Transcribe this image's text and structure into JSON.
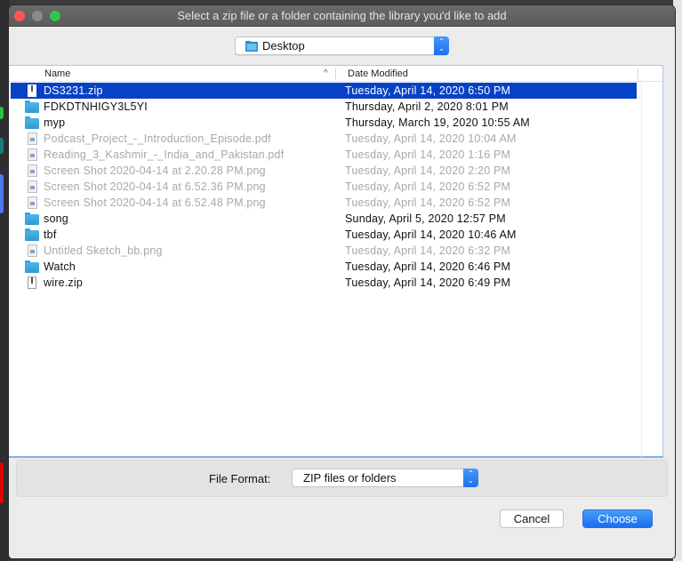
{
  "window": {
    "title": "Select a zip file or a folder containing the library you'd like to add"
  },
  "location": {
    "icon": "folder-icon",
    "selected": "Desktop"
  },
  "table": {
    "columns": {
      "name": "Name",
      "sort_indicator": "^",
      "date": "Date Modified"
    },
    "rows": [
      {
        "name": "DS3231.zip",
        "date": "Tuesday, April 14, 2020 6:50 PM",
        "type": "zip",
        "state": "selected"
      },
      {
        "name": "FDKDTNHIGY3L5YI",
        "date": "Thursday, April 2, 2020 8:01 PM",
        "type": "folder",
        "state": "enabled"
      },
      {
        "name": "myp",
        "date": "Thursday, March 19, 2020 10:55 AM",
        "type": "folder",
        "state": "enabled"
      },
      {
        "name": "Podcast_Project_-_Introduction_Episode.pdf",
        "date": "Tuesday, April 14, 2020 10:04 AM",
        "type": "document",
        "state": "disabled"
      },
      {
        "name": "Reading_3_Kashmir_-_India_and_Pakistan.pdf",
        "date": "Tuesday, April 14, 2020 1:16 PM",
        "type": "document",
        "state": "disabled"
      },
      {
        "name": "Screen Shot 2020-04-14 at 2.20.28 PM.png",
        "date": "Tuesday, April 14, 2020 2:20 PM",
        "type": "image",
        "state": "disabled"
      },
      {
        "name": "Screen Shot 2020-04-14 at 6.52.36 PM.png",
        "date": "Tuesday, April 14, 2020 6:52 PM",
        "type": "image",
        "state": "disabled"
      },
      {
        "name": "Screen Shot 2020-04-14 at 6.52.48 PM.png",
        "date": "Tuesday, April 14, 2020 6:52 PM",
        "type": "image",
        "state": "disabled"
      },
      {
        "name": "song",
        "date": "Sunday, April 5, 2020 12:57 PM",
        "type": "folder",
        "state": "enabled"
      },
      {
        "name": "tbf",
        "date": "Tuesday, April 14, 2020 10:46 AM",
        "type": "folder",
        "state": "enabled"
      },
      {
        "name": "Untitled Sketch_bb.png",
        "date": "Tuesday, April 14, 2020 6:32 PM",
        "type": "image",
        "state": "disabled"
      },
      {
        "name": "Watch",
        "date": "Tuesday, April 14, 2020 6:46 PM",
        "type": "folder",
        "state": "enabled"
      },
      {
        "name": "wire.zip",
        "date": "Tuesday, April 14, 2020 6:49 PM",
        "type": "zip",
        "state": "enabled"
      }
    ]
  },
  "file_format": {
    "label": "File Format:",
    "selected": "ZIP files or folders"
  },
  "buttons": {
    "cancel": "Cancel",
    "choose": "Choose"
  },
  "colors": {
    "selection": "#0742c6",
    "accent": "#1d6ff0",
    "disabled_text": "#a8a8a8"
  }
}
